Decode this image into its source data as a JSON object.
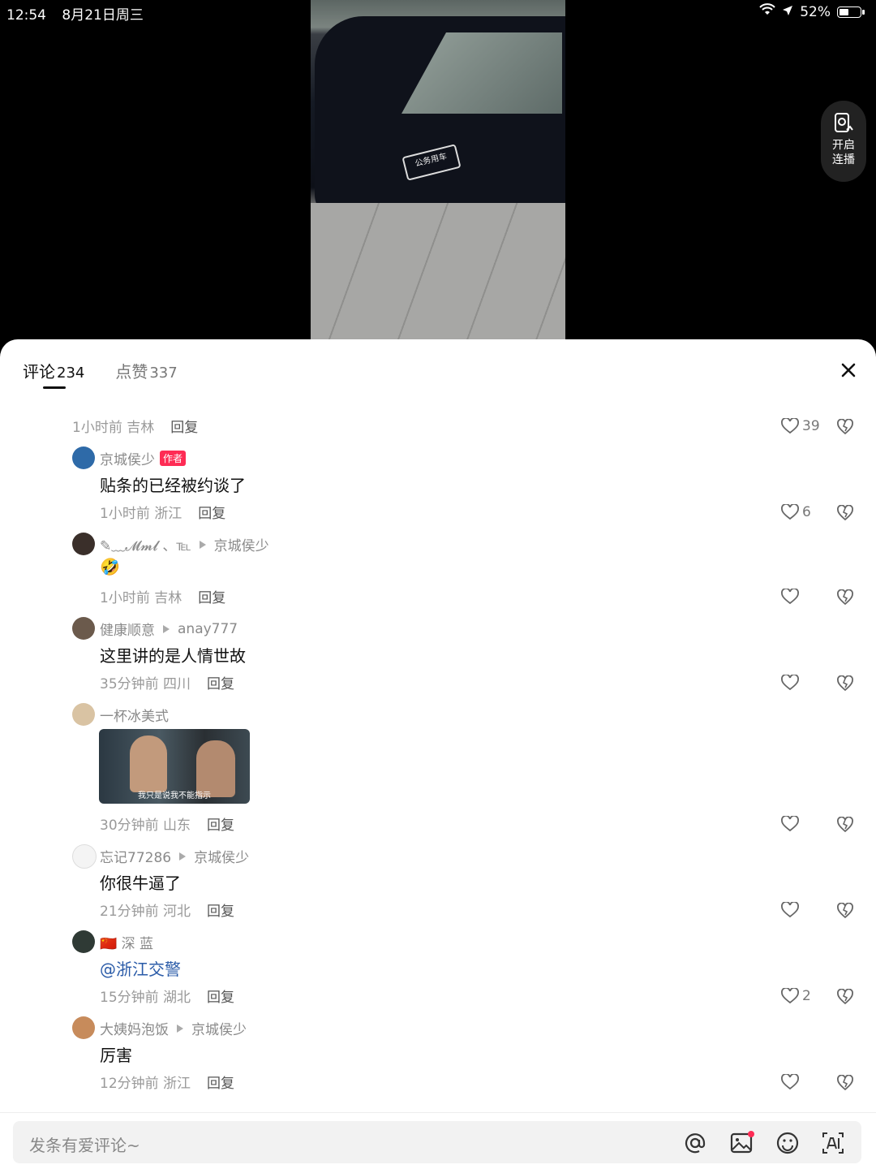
{
  "status": {
    "time": "12:54",
    "date": "8月21日周三",
    "battery": "52%",
    "battery_level": 0.52
  },
  "video": {
    "door_text": "公务用车"
  },
  "lianbo": {
    "line1": "开启",
    "line2": "连播"
  },
  "tabs": [
    {
      "label": "评论",
      "count": "234"
    },
    {
      "label": "点赞",
      "count": "337"
    }
  ],
  "comments": [
    {
      "meta": "1小时前 吉林",
      "reply": "回复",
      "likes": "39"
    },
    {
      "name": "京城侯少",
      "author_tag": "作者",
      "text": "贴条的已经被约谈了",
      "meta": "1小时前 浙江",
      "reply": "回复",
      "likes": "6"
    },
    {
      "name": "✎﹏𝓜𝓶𝓵 、℡",
      "reply_to": "京城侯少",
      "text": "🤣",
      "meta": "1小时前 吉林",
      "reply": "回复",
      "likes": ""
    },
    {
      "name": "健康顺意",
      "reply_to": "anay777",
      "text": "这里讲的是人情世故",
      "meta": "35分钟前 四川",
      "reply": "回复",
      "likes": ""
    },
    {
      "name": "一杯冰美式",
      "image_caption": "我只是说我不能指示",
      "meta": "30分钟前 山东",
      "reply": "回复",
      "likes": ""
    },
    {
      "name": "忘记77286",
      "reply_to": "京城侯少",
      "text": "你很牛逼了",
      "meta": "21分钟前 河北",
      "reply": "回复",
      "likes": ""
    },
    {
      "name": "🇨🇳 深 蓝",
      "text": "@浙江交警",
      "meta": "15分钟前 湖北",
      "reply": "回复",
      "likes": "2"
    },
    {
      "name": "大姨妈泡饭",
      "reply_to": "京城侯少",
      "text": "厉害",
      "meta": "12分钟前 浙江",
      "reply": "回复",
      "likes": ""
    }
  ],
  "input": {
    "placeholder": "发条有爱评论~"
  },
  "colors": {
    "accent": "#fe2c55",
    "mention": "#2a5ba8"
  }
}
